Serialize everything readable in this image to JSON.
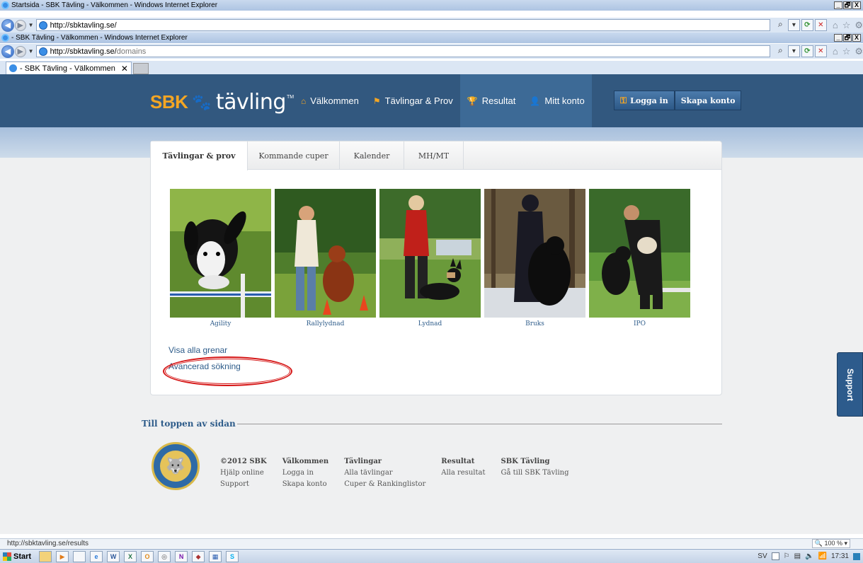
{
  "outer_window": {
    "title": "Startsida - SBK Tävling - Välkommen - Windows Internet Explorer",
    "address_domain": "http://sbktavling.se/",
    "address_path": ""
  },
  "inner_window": {
    "title": "- SBK Tävling - Välkommen - Windows Internet Explorer",
    "address_domain": "http://sbktavling.se/",
    "address_path": "domains"
  },
  "window_buttons": {
    "minimize": "_",
    "restore": "🗗",
    "close": "X"
  },
  "browser_tab": {
    "label": "- SBK Tävling - Välkommen",
    "close": "✕"
  },
  "site": {
    "logo_brand": "SBK",
    "logo_word": "tävling",
    "logo_tm": "TM",
    "nav": [
      {
        "label": "Välkommen",
        "icon": "home-icon"
      },
      {
        "label": "Tävlingar & Prov",
        "icon": "flag-icon"
      },
      {
        "label": "Resultat",
        "icon": "trophy-icon"
      },
      {
        "label": "Mitt konto",
        "icon": "user-icon"
      }
    ],
    "login_label": "Logga in",
    "signup_label": "Skapa konto"
  },
  "content_tabs": [
    {
      "label": "Tävlingar & prov",
      "active": true
    },
    {
      "label": "Kommande cuper",
      "active": false
    },
    {
      "label": "Kalender",
      "active": false
    },
    {
      "label": "MH/MT",
      "active": false
    }
  ],
  "gallery": [
    {
      "caption": "Agility"
    },
    {
      "caption": "Rallylydnad"
    },
    {
      "caption": "Lydnad"
    },
    {
      "caption": "Bruks"
    },
    {
      "caption": "IPO"
    }
  ],
  "links": {
    "show_all": "Visa alla grenar",
    "advanced_search": "Avancerad sökning"
  },
  "to_top": "Till toppen av sidan",
  "footer": {
    "columns": [
      {
        "heading": "©2012 SBK",
        "items": [
          "Hjälp online",
          "Support"
        ]
      },
      {
        "heading": "Välkommen",
        "items": [
          "Logga in",
          "Skapa konto"
        ]
      },
      {
        "heading": "Tävlingar",
        "items": [
          "Alla tävlingar",
          "Cuper & Rankinglistor"
        ]
      },
      {
        "heading": "Resultat",
        "items": [
          "Alla resultat"
        ]
      },
      {
        "heading": "SBK Tävling",
        "items": [
          "Gå till SBK Tävling"
        ]
      }
    ]
  },
  "support_label": "Support",
  "status": {
    "url": "http://sbktavling.se/results",
    "zoom": "100 %"
  },
  "taskbar": {
    "start_label": "Start",
    "lang": "SV",
    "time": "17:31"
  },
  "colors": {
    "header": "#32587f",
    "accent": "#f5a623",
    "link": "#2e5c8a",
    "annotation": "#d51414"
  }
}
